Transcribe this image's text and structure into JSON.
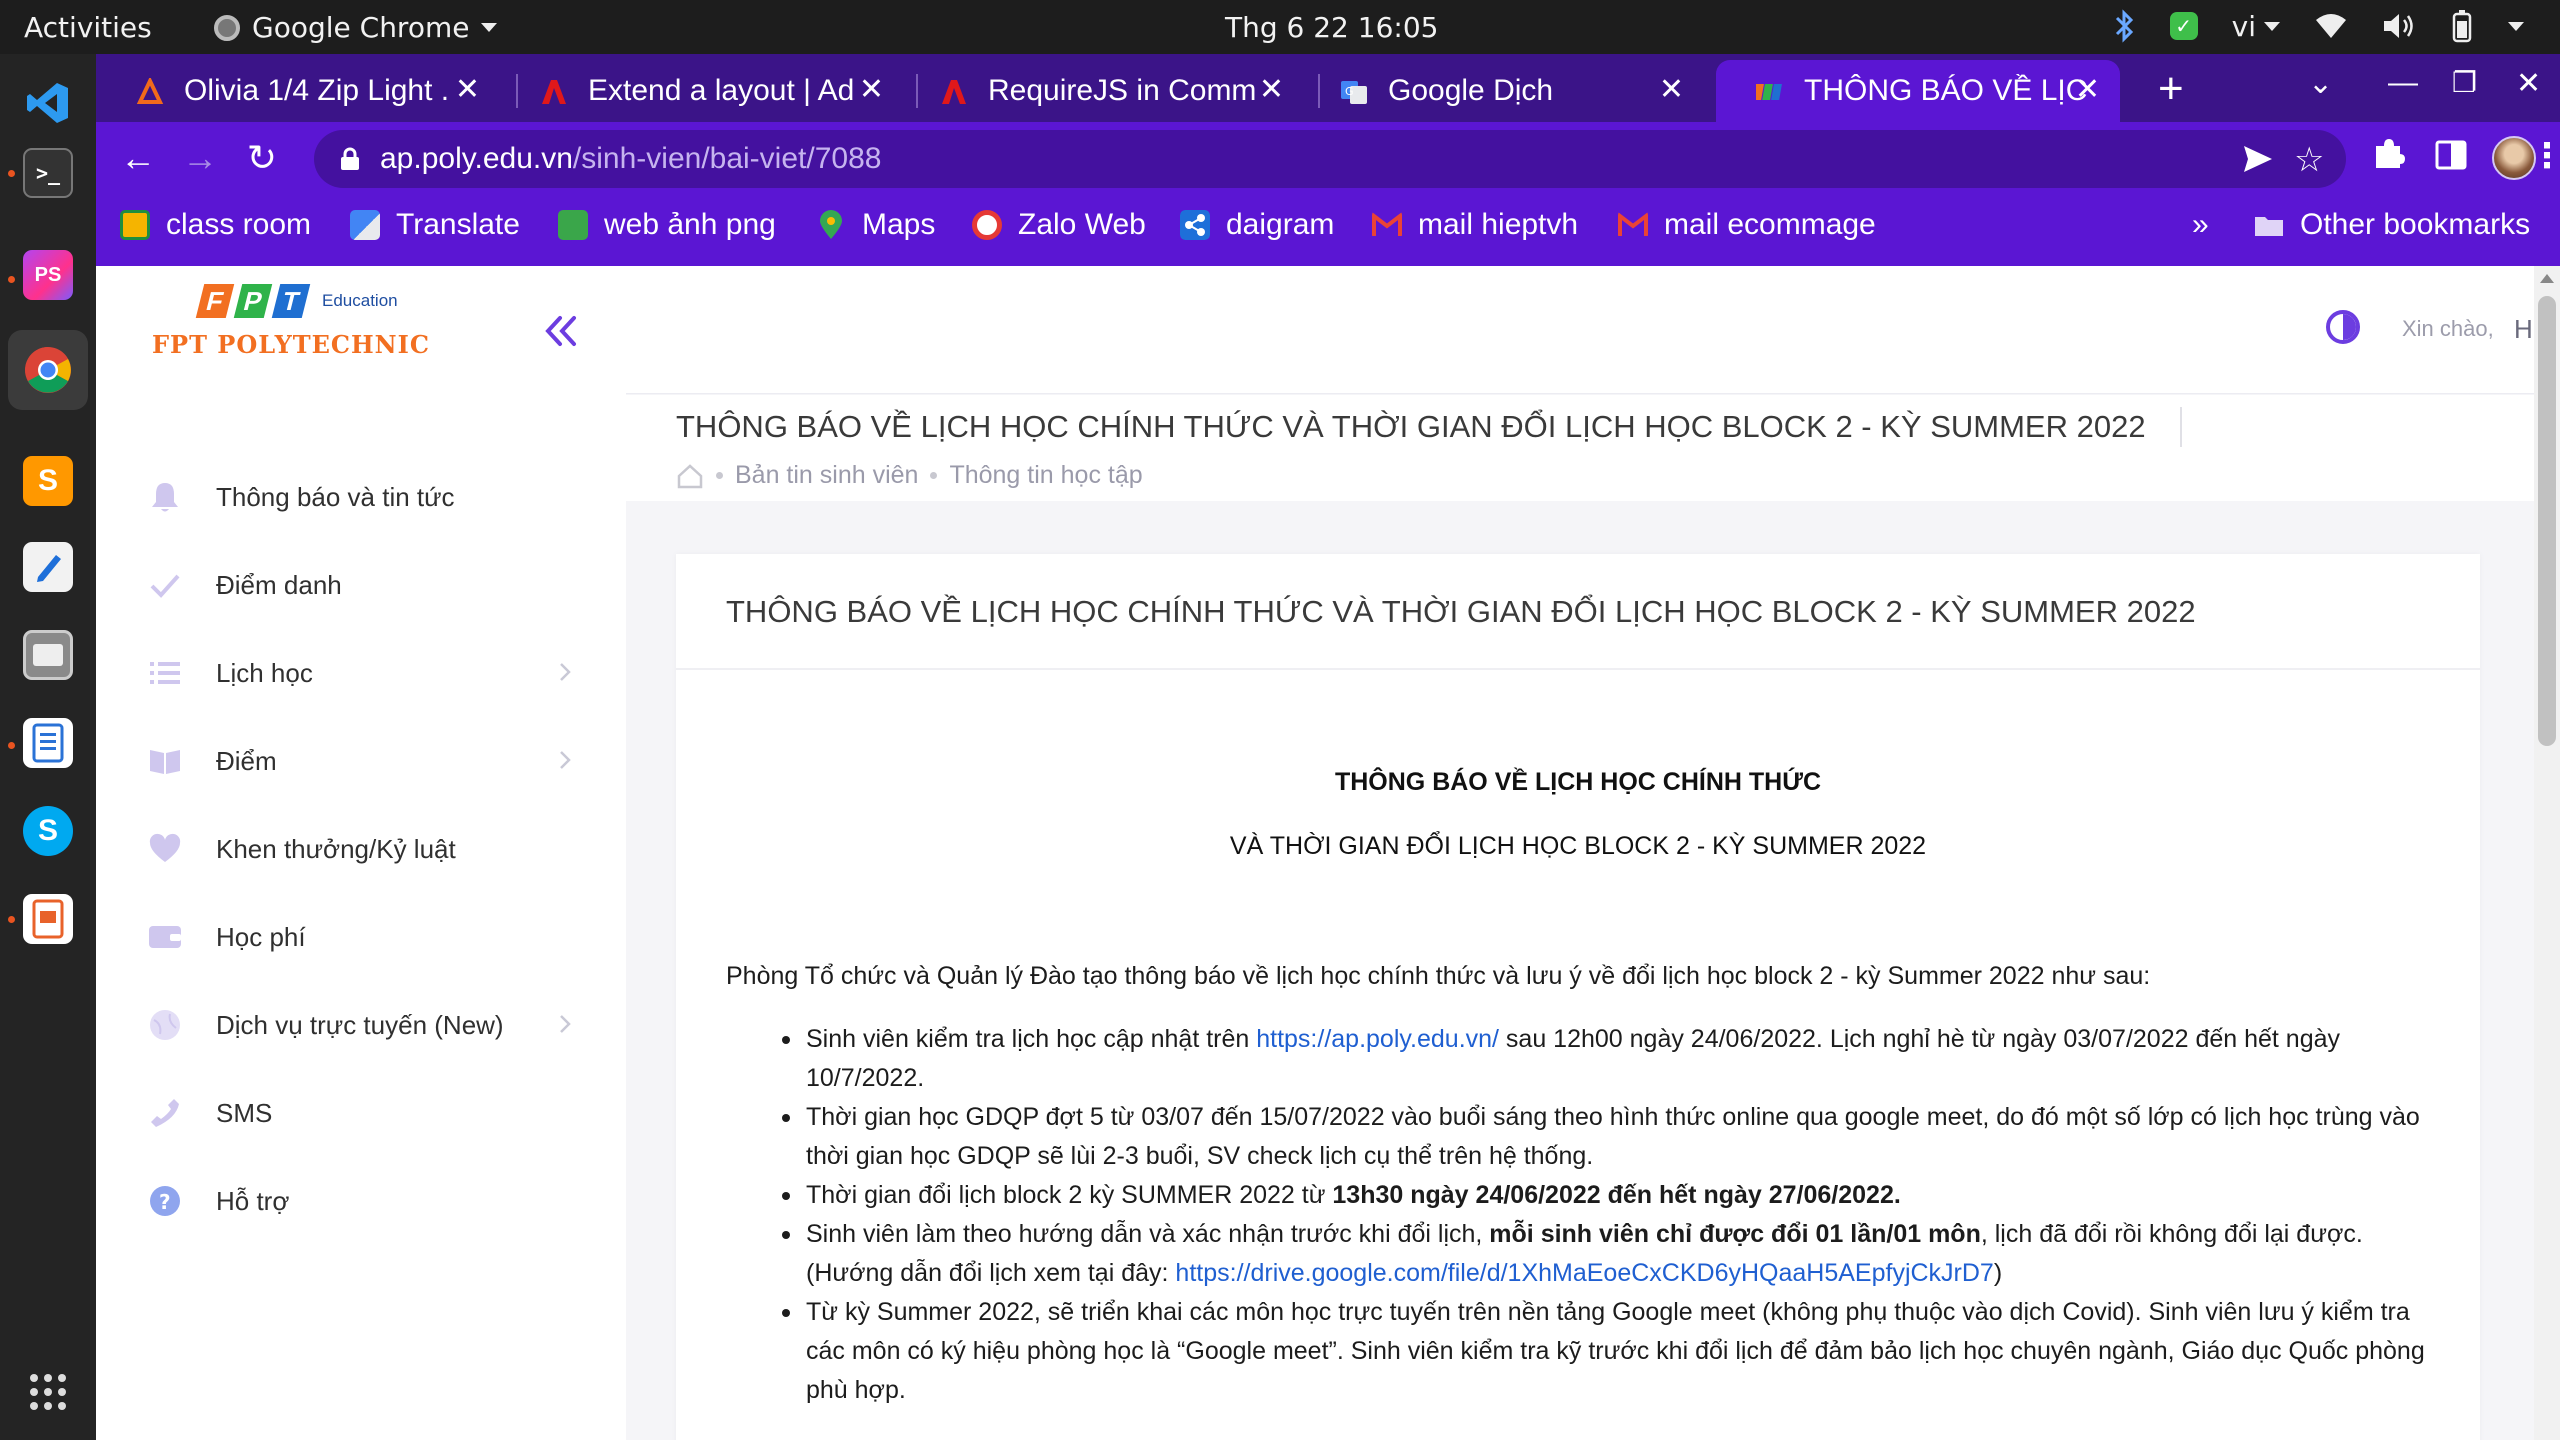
{
  "os": {
    "activities": "Activities",
    "app_name": "Google Chrome",
    "clock": "Thg 6 22  16:05",
    "lang": "vi"
  },
  "browser": {
    "tabs": [
      {
        "title": "Olivia 1/4 Zip Light ."
      },
      {
        "title": "Extend a layout | Ad"
      },
      {
        "title": "RequireJS in Comm"
      },
      {
        "title": "Google Dịch"
      },
      {
        "title": "THÔNG BÁO VỀ LỊC"
      }
    ],
    "url_host": "ap.poly.edu.vn",
    "url_path": "/sinh-vien/bai-viet/7088",
    "bookmarks": [
      {
        "label": "class room"
      },
      {
        "label": "Translate"
      },
      {
        "label": "web ảnh png"
      },
      {
        "label": "Maps"
      },
      {
        "label": "Zalo Web"
      },
      {
        "label": "daigram"
      },
      {
        "label": "mail hieptvh"
      },
      {
        "label": "mail ecommage"
      }
    ],
    "bookmarks_more": "»",
    "other_bookmarks": "Other bookmarks"
  },
  "site": {
    "logo_edu": "Education",
    "logo_name": "FPT POLYTECHNIC",
    "menu": [
      {
        "label": "Thông báo và tin tức"
      },
      {
        "label": "Điểm danh"
      },
      {
        "label": "Lịch học"
      },
      {
        "label": "Điểm"
      },
      {
        "label": "Khen thưởng/Kỷ luật"
      },
      {
        "label": "Học phí"
      },
      {
        "label": "Dịch vụ trực tuyến (New)"
      },
      {
        "label": "SMS"
      },
      {
        "label": "Hỗ trợ"
      }
    ],
    "greeting": "Xin chào,",
    "user_name": "Hiệp",
    "page_title": "THÔNG BÁO VỀ LỊCH HỌC CHÍNH THỨC VÀ THỜI GIAN ĐỔI LỊCH HỌC BLOCK 2 - KỲ SUMMER 2022",
    "breadcrumb": [
      "Bản tin sinh viên",
      "Thông tin học tập"
    ],
    "card_title": "THÔNG BÁO VỀ LỊCH HỌC CHÍNH THỨC VÀ THỜI GIAN ĐỔI LỊCH HỌC BLOCK 2 - KỲ SUMMER 2022",
    "doc_h1": "THÔNG BÁO VỀ LỊCH HỌC CHÍNH THỨC",
    "doc_h2": "VÀ THỜI GIAN ĐỔI LỊCH HỌC BLOCK 2 - KỲ SUMMER 2022",
    "doc_intro": "Phòng Tổ chức và Quản lý Đào tạo thông báo về lịch học chính thức và lưu ý về đổi lịch học block 2 - kỳ Summer 2022 như sau:",
    "bullets": {
      "b1_pre": "Sinh viên kiểm tra lịch học cập nhật trên ",
      "b1_link": "https://ap.poly.edu.vn/",
      "b1_post": " sau 12h00 ngày 24/06/2022. Lịch nghỉ hè từ ngày 03/07/2022 đến hết ngày 10/7/2022.",
      "b2": "Thời gian học GDQP đợt 5 từ 03/07 đến 15/07/2022 vào buổi sáng theo hình thức online qua google meet, do đó một số lớp có lịch học trùng vào thời gian học GDQP sẽ lùi 2-3 buổi, SV check lịch cụ thể trên hệ thống.",
      "b3_pre": "Thời gian đổi lịch block 2 kỳ SUMMER 2022 từ ",
      "b3_bold": "13h30 ngày 24/06/2022 đến hết ngày 27/06/2022.",
      "b4_pre": "Sinh viên làm theo hướng dẫn và xác nhận trước khi đổi lịch, ",
      "b4_bold": "mỗi sinh viên chỉ được đổi 01 lần/01 môn",
      "b4_mid": ", lịch đã đổi rồi không đổi lại được. (Hướng dẫn đổi lịch xem tại đây: ",
      "b4_link": "https://drive.google.com/file/d/1XhMaEoeCxCKD6yHQaaH5AEpfyjCkJrD7",
      "b4_post": ")",
      "b5": "Từ kỳ Summer 2022, sẽ triển khai các môn học trực tuyến trên nền tảng Google meet (không phụ thuộc vào dịch Covid). Sinh viên lưu ý kiểm tra các môn có ký hiệu phòng học là “Google meet”. Sinh viên kiểm tra kỹ trước khi đổi lịch để đảm bảo lịch học chuyên ngành, Giáo dục Quốc phòng phù hợp."
    }
  },
  "colors": {
    "tabstrip": "#3b1488",
    "toolbar": "#5b16d3",
    "accent": "#6c3de0",
    "link": "#1f5fd1",
    "logo_orange": "#f26f21"
  }
}
